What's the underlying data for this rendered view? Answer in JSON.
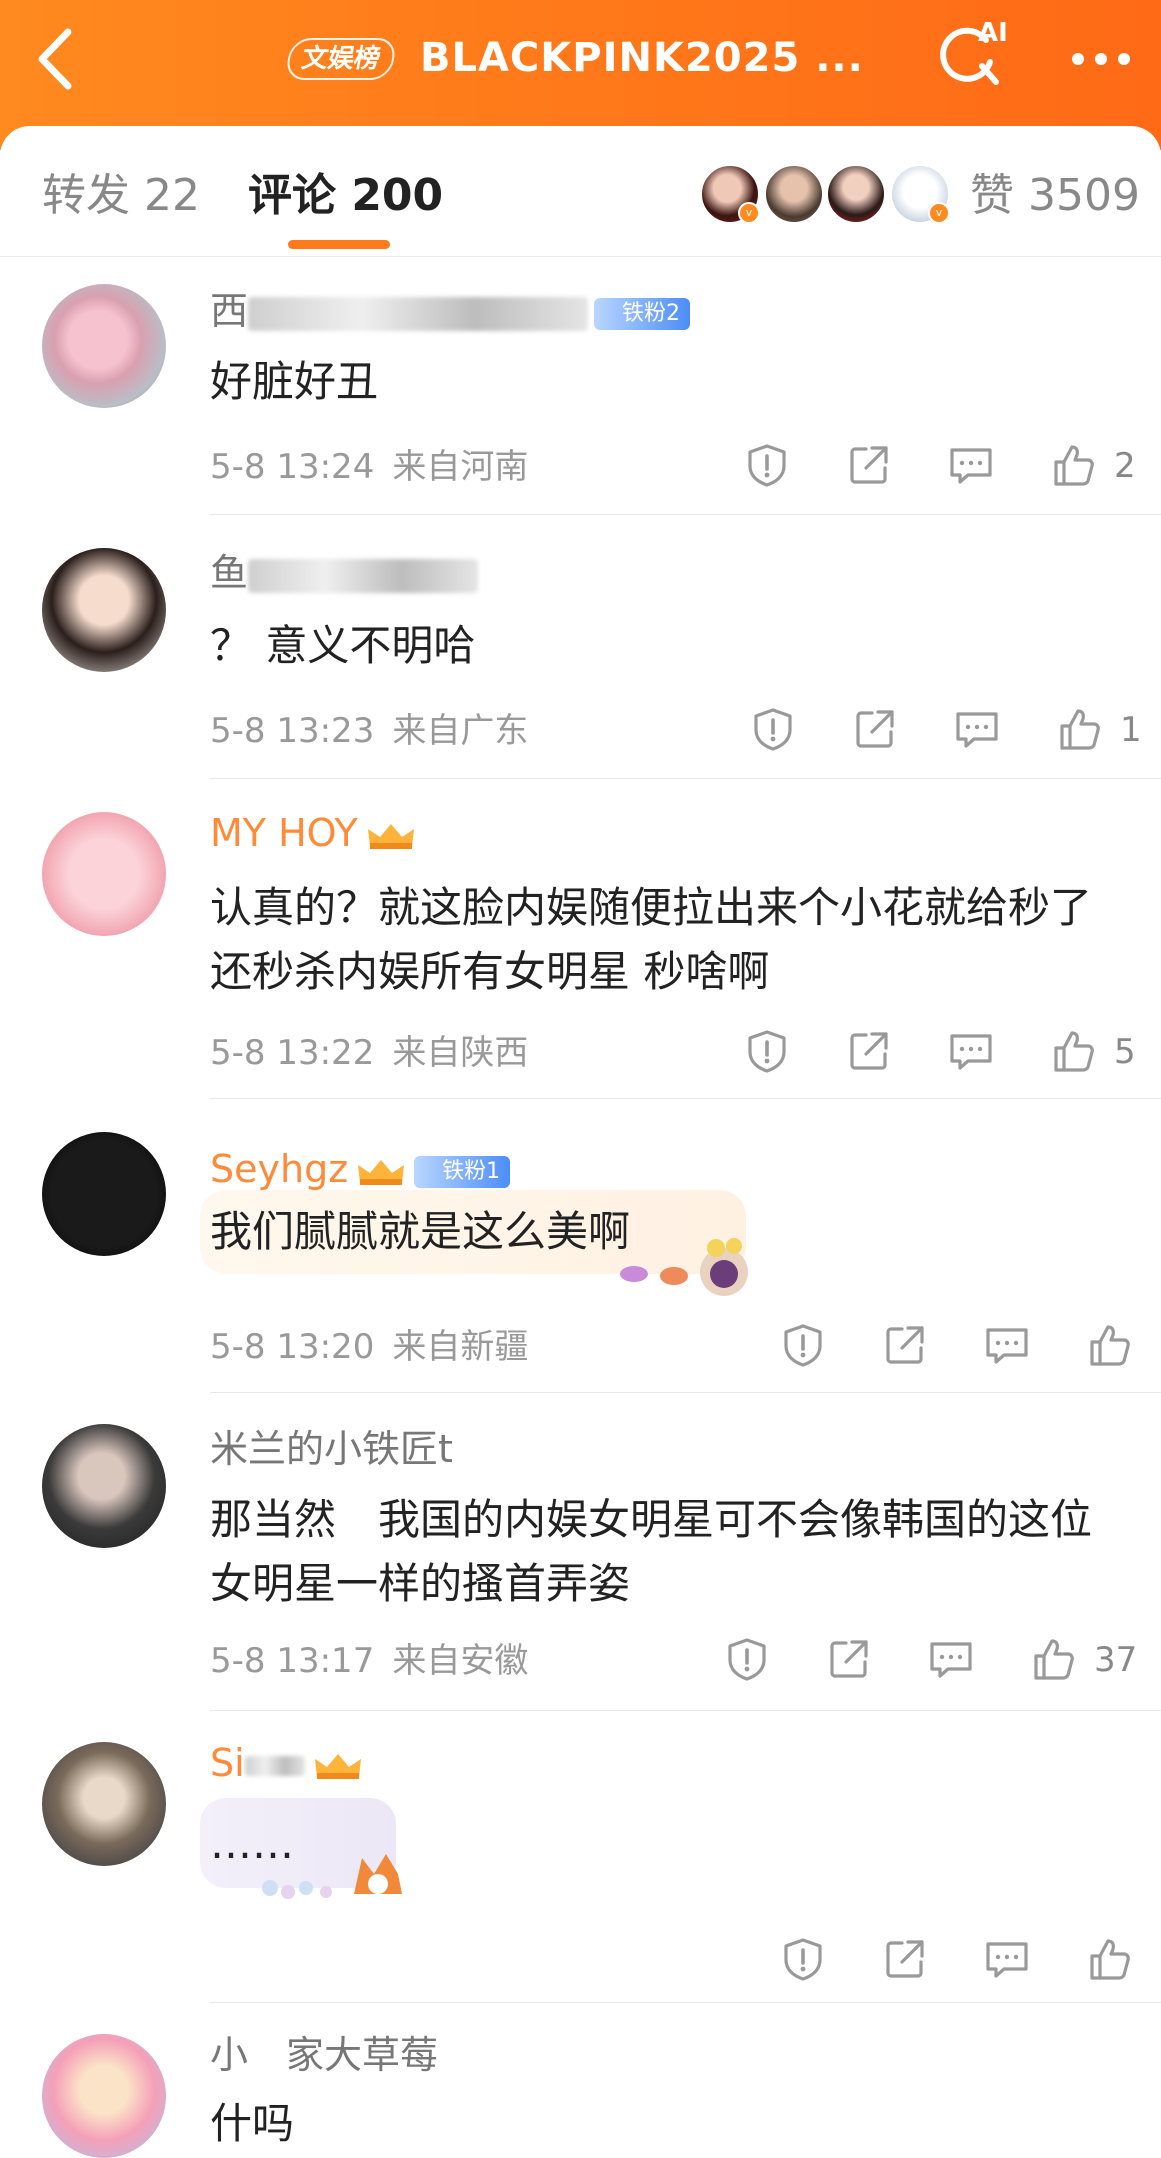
{
  "header": {
    "badge": "文娱榜",
    "title": "BLACKPINK2025 ...",
    "ai_label": "AI"
  },
  "tabs": {
    "repost": "转发 22",
    "comment": "评论 200",
    "likes": "赞 3509"
  },
  "colors": {
    "brand": "#ff7a1a",
    "fan_badge": "#4c8df6"
  },
  "comments": [
    {
      "username": "西",
      "badge": "铁粉2",
      "text": "好脏好丑",
      "time": "5-8 13:24",
      "location": "来自河南",
      "likes": "2"
    },
    {
      "username": "鱼",
      "text": "？ 意义不明哈",
      "time": "5-8 13:23",
      "location": "来自广东",
      "likes": "1"
    },
    {
      "username": "MY HOY",
      "text": "认真的？就这脸内娱随便拉出来个小花就给秒了 还秒杀内娱所有女明星 秒啥啊",
      "time": "5-8 13:22",
      "location": "来自陕西",
      "likes": "5"
    },
    {
      "username": "Seyhgz",
      "badge": "铁粉1",
      "text": "我们腻腻就是这么美啊",
      "time": "5-8 13:20",
      "location": "来自新疆",
      "likes": ""
    },
    {
      "username": "米兰的小铁匠t",
      "text": "那当然　我国的内娱女明星可不会像韩国的这位女明星一样的搔首弄姿",
      "time": "5-8 13:17",
      "location": "来自安徽",
      "likes": "37"
    },
    {
      "username": "Si",
      "text": "……",
      "time": "",
      "location": "",
      "likes": ""
    },
    {
      "username": "小　家大草莓",
      "text": "什吗",
      "time": "",
      "location": "",
      "likes": ""
    }
  ]
}
